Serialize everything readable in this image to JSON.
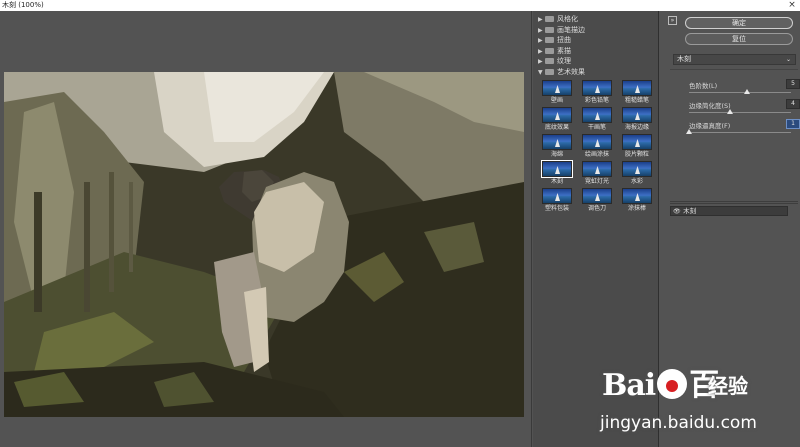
{
  "window": {
    "title": "木刻 (100%)",
    "close_glyph": "×"
  },
  "gallery": {
    "categories": [
      {
        "label": "风格化",
        "expanded": false
      },
      {
        "label": "画笔描边",
        "expanded": false
      },
      {
        "label": "扭曲",
        "expanded": false
      },
      {
        "label": "素描",
        "expanded": false
      },
      {
        "label": "纹理",
        "expanded": false
      },
      {
        "label": "艺术效果",
        "expanded": true
      }
    ],
    "collapsed_arrow": "▶",
    "expanded_arrow": "▼",
    "art_filters": [
      {
        "label": "壁画"
      },
      {
        "label": "彩色铅笔"
      },
      {
        "label": "粗糙蜡笔"
      },
      {
        "label": "底纹效果"
      },
      {
        "label": "干画笔"
      },
      {
        "label": "海报边缘"
      },
      {
        "label": "海绵"
      },
      {
        "label": "绘画涂抹"
      },
      {
        "label": "胶片颗粒"
      },
      {
        "label": "木刻",
        "selected": true
      },
      {
        "label": "霓虹灯光"
      },
      {
        "label": "水彩"
      },
      {
        "label": "塑料包装"
      },
      {
        "label": "调色刀"
      },
      {
        "label": "涂抹棒"
      }
    ]
  },
  "panel": {
    "collapse_glyph": "»",
    "ok_label": "确定",
    "reset_label": "复位",
    "selected_filter": "木刻",
    "dropdown_glyph": "⌄",
    "params": [
      {
        "label": "色阶数(L)",
        "value": "5",
        "level": 0.57
      },
      {
        "label": "边缘简化度(S)",
        "value": "4",
        "level": 0.4
      },
      {
        "label": "边缘逼真度(F)",
        "value": "1",
        "level": 0.0,
        "active": true
      }
    ],
    "effect_layers": [
      {
        "label": "木刻",
        "eye_glyph": "👁"
      }
    ]
  },
  "watermark": {
    "logo_left": "Bai",
    "logo_right": "百",
    "brand": "经验",
    "url": "jingyan.baidu.com"
  },
  "colors": {
    "background": "#535353",
    "gallery": "#4b4b4b",
    "accent_active": "#2b4b7e"
  }
}
